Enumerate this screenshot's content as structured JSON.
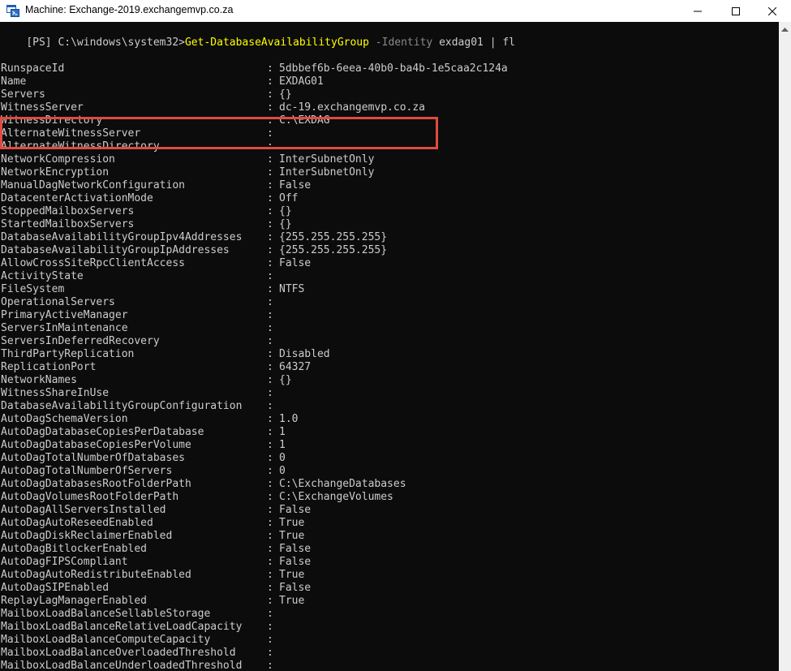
{
  "window": {
    "title": "Machine: Exchange-2019.exchangemvp.co.za"
  },
  "console": {
    "prompt": "[PS] C:\\windows\\system32>",
    "command": "Get-DatabaseAvailabilityGroup",
    "parameter": " -Identity",
    "argument": " exdag01 | fl",
    "properties": [
      {
        "name": "RunspaceId",
        "value": "5dbbef6b-6eea-40b0-ba4b-1e5caa2c124a"
      },
      {
        "name": "Name",
        "value": "EXDAG01"
      },
      {
        "name": "Servers",
        "value": "{}"
      },
      {
        "name": "WitnessServer",
        "value": "dc-19.exchangemvp.co.za"
      },
      {
        "name": "WitnessDirectory",
        "value": "C:\\EXDAG"
      },
      {
        "name": "AlternateWitnessServer",
        "value": ""
      },
      {
        "name": "AlternateWitnessDirectory",
        "value": ""
      },
      {
        "name": "NetworkCompression",
        "value": "InterSubnetOnly"
      },
      {
        "name": "NetworkEncryption",
        "value": "InterSubnetOnly"
      },
      {
        "name": "ManualDagNetworkConfiguration",
        "value": "False"
      },
      {
        "name": "DatacenterActivationMode",
        "value": "Off"
      },
      {
        "name": "StoppedMailboxServers",
        "value": "{}"
      },
      {
        "name": "StartedMailboxServers",
        "value": "{}"
      },
      {
        "name": "DatabaseAvailabilityGroupIpv4Addresses",
        "value": "{255.255.255.255}"
      },
      {
        "name": "DatabaseAvailabilityGroupIpAddresses",
        "value": "{255.255.255.255}"
      },
      {
        "name": "AllowCrossSiteRpcClientAccess",
        "value": "False"
      },
      {
        "name": "ActivityState",
        "value": ""
      },
      {
        "name": "FileSystem",
        "value": "NTFS"
      },
      {
        "name": "OperationalServers",
        "value": ""
      },
      {
        "name": "PrimaryActiveManager",
        "value": ""
      },
      {
        "name": "ServersInMaintenance",
        "value": ""
      },
      {
        "name": "ServersInDeferredRecovery",
        "value": ""
      },
      {
        "name": "ThirdPartyReplication",
        "value": "Disabled"
      },
      {
        "name": "ReplicationPort",
        "value": "64327"
      },
      {
        "name": "NetworkNames",
        "value": "{}"
      },
      {
        "name": "WitnessShareInUse",
        "value": ""
      },
      {
        "name": "DatabaseAvailabilityGroupConfiguration",
        "value": ""
      },
      {
        "name": "AutoDagSchemaVersion",
        "value": "1.0"
      },
      {
        "name": "AutoDagDatabaseCopiesPerDatabase",
        "value": "1"
      },
      {
        "name": "AutoDagDatabaseCopiesPerVolume",
        "value": "1"
      },
      {
        "name": "AutoDagTotalNumberOfDatabases",
        "value": "0"
      },
      {
        "name": "AutoDagTotalNumberOfServers",
        "value": "0"
      },
      {
        "name": "AutoDagDatabasesRootFolderPath",
        "value": "C:\\ExchangeDatabases"
      },
      {
        "name": "AutoDagVolumesRootFolderPath",
        "value": "C:\\ExchangeVolumes"
      },
      {
        "name": "AutoDagAllServersInstalled",
        "value": "False"
      },
      {
        "name": "AutoDagAutoReseedEnabled",
        "value": "True"
      },
      {
        "name": "AutoDagDiskReclaimerEnabled",
        "value": "True"
      },
      {
        "name": "AutoDagBitlockerEnabled",
        "value": "False"
      },
      {
        "name": "AutoDagFIPSCompliant",
        "value": "False"
      },
      {
        "name": "AutoDagAutoRedistributeEnabled",
        "value": "True"
      },
      {
        "name": "AutoDagSIPEnabled",
        "value": "False"
      },
      {
        "name": "ReplayLagManagerEnabled",
        "value": "True"
      },
      {
        "name": "MailboxLoadBalanceSellableStorage",
        "value": ""
      },
      {
        "name": "MailboxLoadBalanceRelativeLoadCapacity",
        "value": ""
      },
      {
        "name": "MailboxLoadBalanceComputeCapacity",
        "value": ""
      },
      {
        "name": "MailboxLoadBalanceOverloadedThreshold",
        "value": ""
      },
      {
        "name": "MailboxLoadBalanceUnderloadedThreshold",
        "value": ""
      }
    ]
  }
}
